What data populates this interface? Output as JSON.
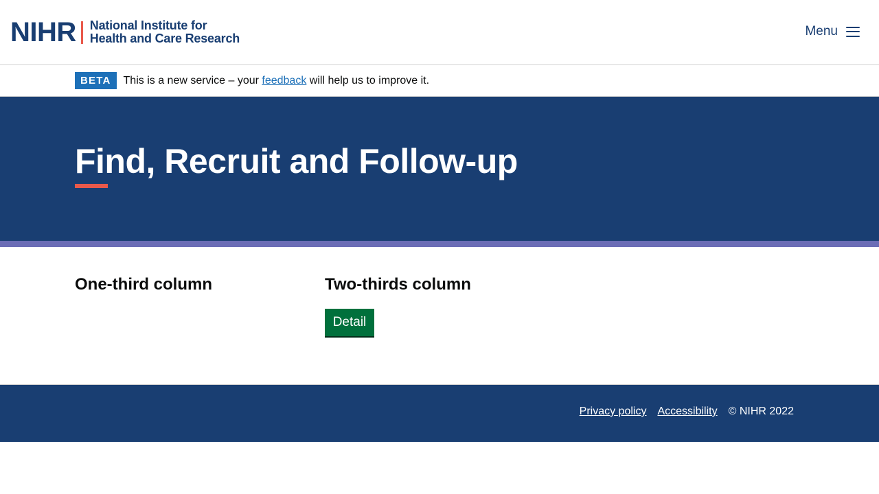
{
  "header": {
    "logo_mark": "NIHR",
    "logo_line1": "National Institute for",
    "logo_line2": "Health and Care Research",
    "menu_label": "Menu"
  },
  "beta_banner": {
    "tag": "BETA",
    "text_before": "This is a new service – your ",
    "link_text": "feedback",
    "text_after": " will help us to improve it."
  },
  "hero": {
    "title": "Find, Recruit and Follow-up"
  },
  "main": {
    "col_one_heading": "One-third column",
    "col_two_heading": "Two-thirds column",
    "detail_button": "Detail"
  },
  "footer": {
    "links": [
      "Privacy policy",
      "Accessibility"
    ],
    "copyright": "© NIHR 2022"
  },
  "colors": {
    "brand_navy": "#193e72",
    "accent_coral": "#e9594b",
    "stripe_purple": "#6b6db6",
    "beta_blue": "#1d70b8",
    "button_green": "#00703c"
  }
}
